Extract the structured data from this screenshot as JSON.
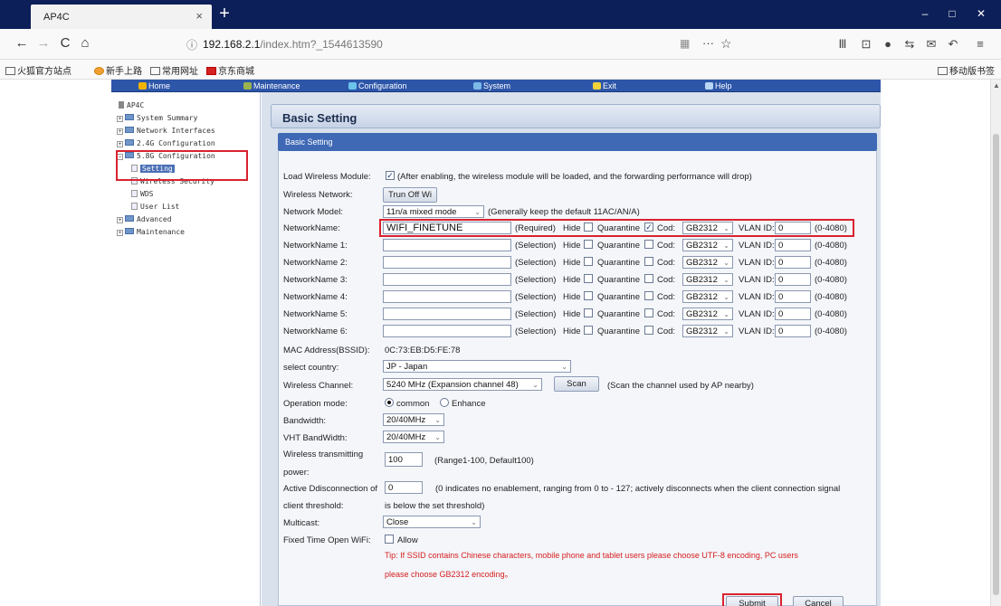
{
  "browser": {
    "tab_title": "AP4C",
    "tab_close": "×",
    "new_tab": "+",
    "window_controls": {
      "minimize": "–",
      "maximize": "□",
      "close": "✕"
    },
    "nav": {
      "back": "←",
      "forward": "→",
      "reload": "C",
      "home": "⌂"
    },
    "url_info_icon": "ⓘ",
    "url_host": "192.168.2.1",
    "url_path": "/index.htm?_1544613590",
    "url_qr": "▦",
    "url_more": "···",
    "url_star": "☆",
    "toolbar_icons": [
      "library-icon",
      "sidebar-icon",
      "extension-icon",
      "sync-icon",
      "chat-icon",
      "undo-icon",
      "menu-icon"
    ],
    "toolbar_glyphs": [
      "Ⅲ",
      "⊡",
      "●",
      "⇆",
      "✉",
      "↶",
      "≡"
    ],
    "bookmarks": [
      "火狐官方站点",
      "新手上路",
      "常用网址",
      "京东商城"
    ],
    "mobile_bookmarks": "移动版书签"
  },
  "topmenu": {
    "home": "Home",
    "maintenance": "Maintenance",
    "configuration": "Configuration",
    "system": "System",
    "exit": "Exit",
    "help": "Help"
  },
  "tree": {
    "root": "AP4C",
    "system_summary": "System Summary",
    "network_interfaces": "Network Interfaces",
    "config_24g": "2.4G Configuration",
    "config_58g": "5.8G Configuration",
    "setting": "Setting",
    "wireless_security": "Wireless Security",
    "wds": "WDS",
    "user_list": "User List",
    "advanced": "Advanced",
    "maintenance": "Maintenance"
  },
  "page": {
    "title": "Basic Setting",
    "section_title": "Basic Setting"
  },
  "form": {
    "load_module_label": "Load Wireless Module:",
    "load_module_checked": true,
    "load_module_note": "(After enabling, the wireless module will be loaded, and the forwarding performance will drop)",
    "wireless_network_label": "Wireless Network:",
    "wireless_network_button": "Trun Off Wi",
    "network_model_label": "Network Model:",
    "network_model_value": "11n/a mixed mode",
    "network_model_note": "(Generally keep the default 11AC/AN/A)",
    "network_names": [
      {
        "label": "NetworkName:",
        "value": "WIFI_FINETUNE",
        "kind": "(Required)",
        "hide": false,
        "quarantine": true,
        "cod": "GB2312",
        "vlan": "0",
        "range": "(0-4080)"
      },
      {
        "label": "NetworkName 1:",
        "value": "",
        "kind": "(Selection)",
        "hide": false,
        "quarantine": false,
        "cod": "GB2312",
        "vlan": "0",
        "range": "(0-4080)"
      },
      {
        "label": "NetworkName 2:",
        "value": "",
        "kind": "(Selection)",
        "hide": false,
        "quarantine": false,
        "cod": "GB2312",
        "vlan": "0",
        "range": "(0-4080)"
      },
      {
        "label": "NetworkName 3:",
        "value": "",
        "kind": "(Selection)",
        "hide": false,
        "quarantine": false,
        "cod": "GB2312",
        "vlan": "0",
        "range": "(0-4080)"
      },
      {
        "label": "NetworkName 4:",
        "value": "",
        "kind": "(Selection)",
        "hide": false,
        "quarantine": false,
        "cod": "GB2312",
        "vlan": "0",
        "range": "(0-4080)"
      },
      {
        "label": "NetworkName 5:",
        "value": "",
        "kind": "(Selection)",
        "hide": false,
        "quarantine": false,
        "cod": "GB2312",
        "vlan": "0",
        "range": "(0-4080)"
      },
      {
        "label": "NetworkName 6:",
        "value": "",
        "kind": "(Selection)",
        "hide": false,
        "quarantine": false,
        "cod": "GB2312",
        "vlan": "0",
        "range": "(0-4080)"
      }
    ],
    "hide_label": "Hide",
    "quarantine_label": "Quarantine",
    "cod_label": "Cod:",
    "vlan_label": "VLAN ID:",
    "mac_label": "MAC Address(BSSID):",
    "mac_value": "0C:73:EB:D5:FE:78",
    "country_label": "select country:",
    "country_value": "JP - Japan",
    "channel_label": "Wireless Channel:",
    "channel_value": "5240 MHz (Expansion channel 48)",
    "scan_button": "Scan",
    "scan_note": "(Scan the channel used by AP nearby)",
    "operation_label": "Operation mode:",
    "op_common": "common",
    "op_enhance": "Enhance",
    "op_common_selected": true,
    "bandwidth_label": "Bandwidth:",
    "bandwidth_value": "20/40MHz",
    "vht_label": "VHT BandWidth:",
    "vht_value": "20/40MHz",
    "tx_label_1": "Wireless transmitting",
    "tx_label_2": "power:",
    "tx_value": "100",
    "tx_note": "(Range1-100,   Default100)",
    "active_label": "Active Ddisconnection of",
    "active_value": "0",
    "active_note": "(0 indicates no enablement, ranging from 0 to - 127; actively disconnects when the client connection signal",
    "client_label": "client threshold:",
    "client_note": "is below the set threshold)",
    "multicast_label": "Multicast:",
    "multicast_value": "Close",
    "fixed_label": "Fixed Time Open WiFi:",
    "fixed_allow": "Allow",
    "fixed_checked": false,
    "tip_1": "Tip: If SSID contains Chinese characters, mobile phone and tablet users please choose UTF-8 encoding, PC users",
    "tip_2": "please choose GB2312 encoding。",
    "submit": "Submit",
    "cancel": "Cancel"
  },
  "colors": {
    "browser_titlebar": "#0d1f59",
    "menu_bar": "#2d56a9",
    "section_bar": "#3f69b5",
    "highlight": "#d9232f",
    "tip_text": "#d62020"
  }
}
